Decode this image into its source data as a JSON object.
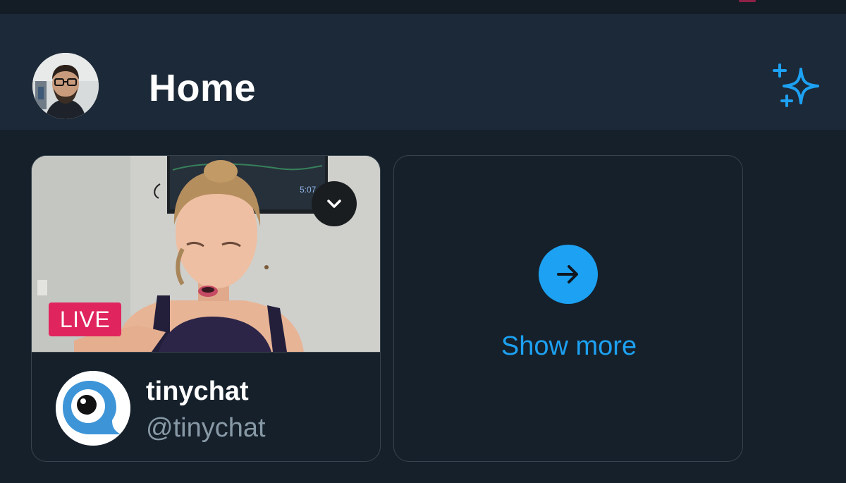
{
  "header": {
    "title": "Home",
    "avatar_icon": "user-avatar",
    "sparkle_icon": "sparkle-icon"
  },
  "live_card": {
    "badge": "LIVE",
    "tv_clock": "5:07",
    "channel_name": "tinychat",
    "channel_handle": "@tinychat",
    "menu_icon": "chevron-down-icon",
    "logo_icon": "tinychat-logo"
  },
  "more_card": {
    "label": "Show more",
    "icon": "arrow-right-icon"
  },
  "colors": {
    "background": "#15202b",
    "header": "#1c2938",
    "accent": "#1da1f2",
    "live": "#e0245e",
    "muted_text": "#8899a6",
    "border": "#38444d"
  }
}
